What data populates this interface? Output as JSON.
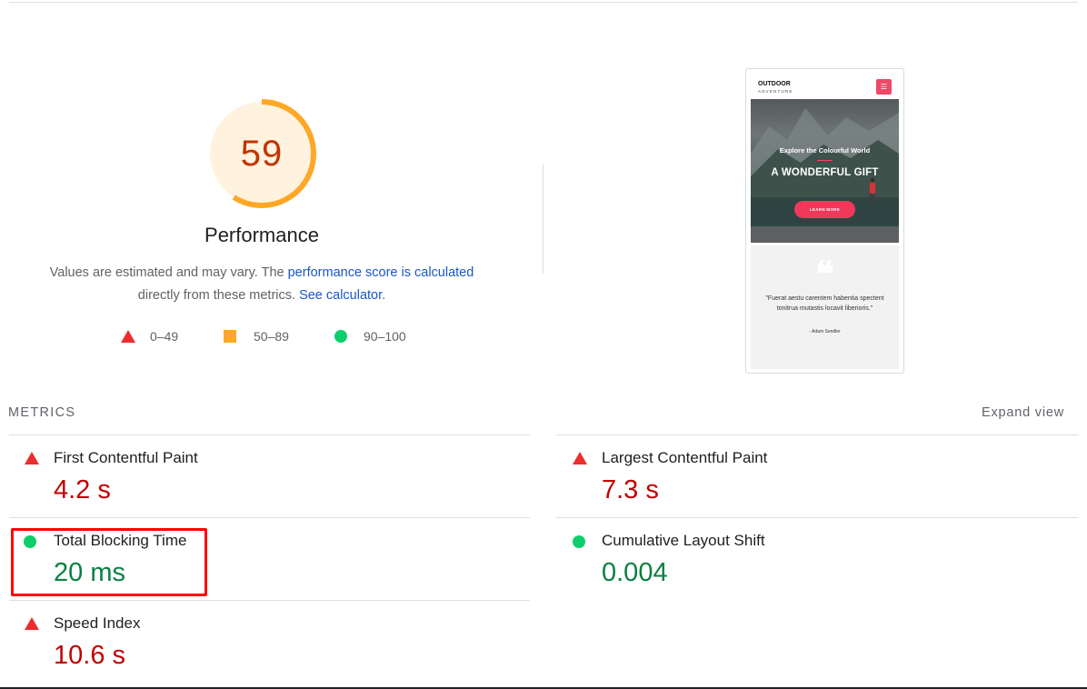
{
  "score": {
    "value": "59",
    "fraction": 0.59,
    "category_label": "Performance",
    "ring_color": "#ffa726",
    "ring_bg": "#fff3e0",
    "text_color": "#c33300"
  },
  "explanation": {
    "text_before": "Values are estimated and may vary. The ",
    "link1": "performance score is calculated",
    "text_middle": "directly from these metrics. ",
    "link2": "See calculator",
    "text_after": "."
  },
  "legend": {
    "fail": "0–49",
    "average": "50–89",
    "pass": "90–100"
  },
  "screenshot": {
    "logo_line1": "OUTDOOR",
    "logo_line2": "ADVENTURE",
    "menu_icon": "☰",
    "hero_sub": "Explore the Colourful World",
    "hero_title": "A WONDERFUL GIFT",
    "hero_button": "LEARN MORE",
    "quote_mark": "❝",
    "quote_text": "\"Fuerat aestu carentem habentia spectent tonitrua mutastis locavit liberioris.\"",
    "quote_author": "- Adam Sendler"
  },
  "metrics_section": {
    "title": "METRICS",
    "expand_label": "Expand view"
  },
  "metrics": {
    "fcp": {
      "label": "First Contentful Paint",
      "value": "4.2 s",
      "status": "fail"
    },
    "lcp": {
      "label": "Largest Contentful Paint",
      "value": "7.3 s",
      "status": "fail"
    },
    "tbt": {
      "label": "Total Blocking Time",
      "value": "20 ms",
      "status": "pass"
    },
    "cls": {
      "label": "Cumulative Layout Shift",
      "value": "0.004",
      "status": "pass"
    },
    "si": {
      "label": "Speed Index",
      "value": "10.6 s",
      "status": "fail"
    }
  },
  "colors": {
    "fail": "#eb2d2d",
    "average": "#ffa726",
    "pass": "#0cce6b",
    "fail_text": "#c00000",
    "pass_text": "#0b8043",
    "link": "#1a56c9",
    "highlight": "#ff0000"
  }
}
